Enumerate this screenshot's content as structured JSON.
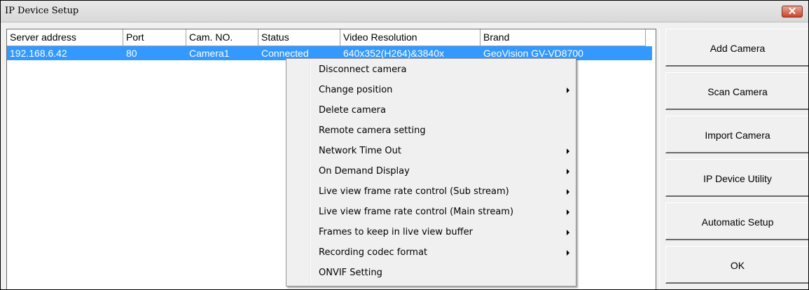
{
  "window": {
    "title": "IP Device Setup",
    "close_label": "✕"
  },
  "columns": [
    "Server address",
    "Port",
    "Cam. NO.",
    "Status",
    "Video Resolution",
    "Brand"
  ],
  "rows": [
    {
      "server": "192.168.6.42",
      "port": "80",
      "cam_no": "Camera1",
      "status": "Connected",
      "resolution": "640x352(H264)&3840x",
      "brand": "GeoVision GV-VD8700"
    }
  ],
  "buttons": {
    "add": "Add Camera",
    "scan": "Scan Camera",
    "import": "Import Camera",
    "utility": "IP Device Utility",
    "auto": "Automatic Setup",
    "ok": "OK"
  },
  "context_menu": [
    {
      "label": "Disconnect camera",
      "submenu": false
    },
    {
      "label": "Change position",
      "submenu": true
    },
    {
      "label": "Delete camera",
      "submenu": false
    },
    {
      "label": "Remote camera setting",
      "submenu": false
    },
    {
      "label": "Network Time Out",
      "submenu": true
    },
    {
      "label": "On Demand Display",
      "submenu": true
    },
    {
      "label": "Live view frame rate control (Sub stream)",
      "submenu": true
    },
    {
      "label": "Live view frame rate control (Main stream)",
      "submenu": true
    },
    {
      "label": "Frames to keep in live view buffer",
      "submenu": true
    },
    {
      "label": "Recording codec format",
      "submenu": true
    },
    {
      "label": "ONVIF Setting",
      "submenu": false
    }
  ],
  "colors": {
    "selection": "#3399ff",
    "close_button": "#c9462c"
  }
}
